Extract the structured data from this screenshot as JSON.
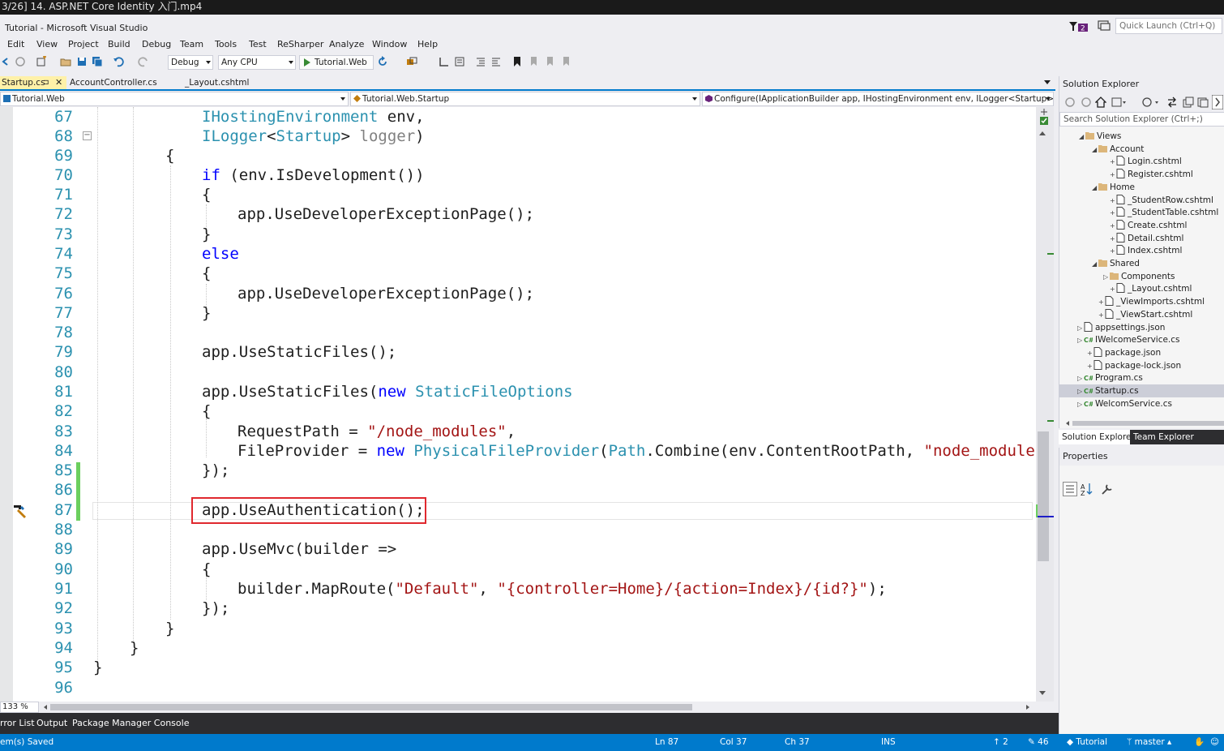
{
  "video": {
    "title": "3/26] 14. ASP.NET Core Identity 入门.mp4"
  },
  "window": {
    "title": "Tutorial - Microsoft Visual Studio",
    "quick_launch_placeholder": "Quick Launch (Ctrl+Q)",
    "notification_count": "2"
  },
  "menu": [
    "Edit",
    "View",
    "Project",
    "Build",
    "Debug",
    "Team",
    "Tools",
    "Test",
    "ReSharper",
    "Analyze",
    "Window",
    "Help"
  ],
  "toolbar": {
    "configuration": "Debug",
    "platform": "Any CPU",
    "run_target": "Tutorial.Web"
  },
  "tabs": [
    {
      "label": "Startup.cs",
      "active": true
    },
    {
      "label": "AccountController.cs",
      "active": false
    },
    {
      "label": "_Layout.cshtml",
      "active": false
    }
  ],
  "navbar": {
    "project": "Tutorial.Web",
    "type": "Tutorial.Web.Startup",
    "member": "Configure(IApplicationBuilder app, IHostingEnvironment env, ILogger<Startup> logger)"
  },
  "code_lines": [
    {
      "n": "67",
      "text": "IHostingEnvironment env,"
    },
    {
      "n": "68",
      "text": "ILogger<Startup> logger)"
    },
    {
      "n": "69",
      "text": "{"
    },
    {
      "n": "70",
      "text": "if (env.IsDevelopment())"
    },
    {
      "n": "71",
      "text": "{"
    },
    {
      "n": "72",
      "text": "app.UseDeveloperExceptionPage();"
    },
    {
      "n": "73",
      "text": "}"
    },
    {
      "n": "74",
      "text": "else"
    },
    {
      "n": "75",
      "text": "{"
    },
    {
      "n": "76",
      "text": "app.UseDeveloperExceptionPage();"
    },
    {
      "n": "77",
      "text": "}"
    },
    {
      "n": "78",
      "text": ""
    },
    {
      "n": "79",
      "text": "app.UseStaticFiles();"
    },
    {
      "n": "80",
      "text": ""
    },
    {
      "n": "81",
      "text": "app.UseStaticFiles(new StaticFileOptions"
    },
    {
      "n": "82",
      "text": "{"
    },
    {
      "n": "83",
      "text": "RequestPath = \"/node_modules\","
    },
    {
      "n": "84",
      "text": "FileProvider = new PhysicalFileProvider(Path.Combine(env.ContentRootPath, \"node_modules\""
    },
    {
      "n": "85",
      "text": "});"
    },
    {
      "n": "86",
      "text": ""
    },
    {
      "n": "87",
      "text": "app.UseAuthentication();"
    },
    {
      "n": "88",
      "text": ""
    },
    {
      "n": "89",
      "text": "app.UseMvc(builder =>"
    },
    {
      "n": "90",
      "text": "{"
    },
    {
      "n": "91",
      "text": "builder.MapRoute(\"Default\", \"{controller=Home}/{action=Index}/{id?}\");"
    },
    {
      "n": "92",
      "text": "});"
    },
    {
      "n": "93",
      "text": "}"
    },
    {
      "n": "94",
      "text": "}"
    },
    {
      "n": "95",
      "text": "}"
    },
    {
      "n": "96",
      "text": ""
    }
  ],
  "editor": {
    "zoom": "133 %"
  },
  "solution_explorer": {
    "title": "Solution Explorer",
    "search_placeholder": "Search Solution Explorer (Ctrl+;)",
    "items": [
      {
        "label": "Views",
        "kind": "folder",
        "expander": "open"
      },
      {
        "label": "Account",
        "kind": "folder",
        "expander": "open"
      },
      {
        "label": "Login.cshtml",
        "kind": "file",
        "expander": ""
      },
      {
        "label": "Register.cshtml",
        "kind": "file",
        "expander": ""
      },
      {
        "label": "Home",
        "kind": "folder",
        "expander": "open"
      },
      {
        "label": "_StudentRow.cshtml",
        "kind": "file",
        "expander": ""
      },
      {
        "label": "_StudentTable.cshtml",
        "kind": "file",
        "expander": ""
      },
      {
        "label": "Create.cshtml",
        "kind": "file",
        "expander": ""
      },
      {
        "label": "Detail.cshtml",
        "kind": "file",
        "expander": ""
      },
      {
        "label": "Index.cshtml",
        "kind": "file",
        "expander": ""
      },
      {
        "label": "Shared",
        "kind": "folder",
        "expander": "open"
      },
      {
        "label": "Components",
        "kind": "folder",
        "expander": "closed"
      },
      {
        "label": "_Layout.cshtml",
        "kind": "file",
        "expander": ""
      },
      {
        "label": "_ViewImports.cshtml",
        "kind": "file",
        "expander": ""
      },
      {
        "label": "_ViewStart.cshtml",
        "kind": "file",
        "expander": ""
      },
      {
        "label": "appsettings.json",
        "kind": "json",
        "expander": "closed"
      },
      {
        "label": "IWelcomeService.cs",
        "kind": "cs",
        "expander": "closed"
      },
      {
        "label": "package.json",
        "kind": "json",
        "expander": ""
      },
      {
        "label": "package-lock.json",
        "kind": "json",
        "expander": ""
      },
      {
        "label": "Program.cs",
        "kind": "cs",
        "expander": "closed"
      },
      {
        "label": "Startup.cs",
        "kind": "cs",
        "expander": "closed",
        "selected": true
      },
      {
        "label": "WelcomService.cs",
        "kind": "cs",
        "expander": "closed"
      }
    ],
    "tabs": [
      "Solution Explorer",
      "Team Explorer"
    ]
  },
  "properties": {
    "title": "Properties"
  },
  "bottom_tabs": [
    "rror List",
    "Output",
    "Package Manager Console"
  ],
  "status": {
    "message": "em(s) Saved",
    "line": "Ln 87",
    "col": "Col 37",
    "ch": "Ch 37",
    "mode": "INS",
    "up_count": "2",
    "edit_count": "46",
    "repo": "Tutorial",
    "branch": "master"
  },
  "colors": {
    "accent": "#007acc",
    "keyword": "#0000ff",
    "type": "#2b91af",
    "string": "#a31515",
    "highlight": "#e0282e"
  }
}
